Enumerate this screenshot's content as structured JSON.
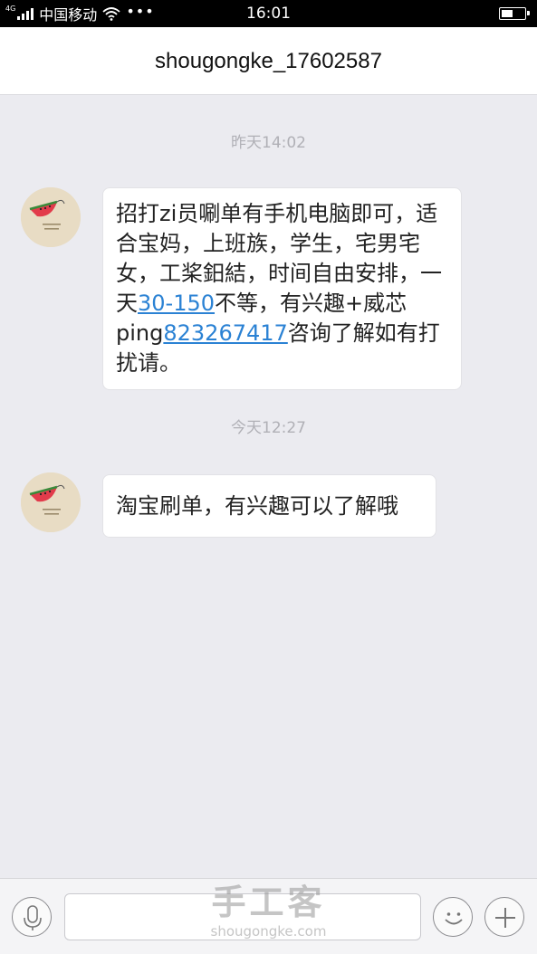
{
  "status_bar": {
    "network_type": "4G",
    "carrier": "中国移动",
    "more": "•••",
    "time": "16:01",
    "battery_level": 0.5
  },
  "header": {
    "title": "shougongke_17602587"
  },
  "messages": [
    {
      "timestamp": "昨天14:02",
      "text_parts": [
        "招打zi员唰单有手机电脑即可，适合宝妈，上班族，学生，宅男宅女，工桨鈤結，时间自由安排，一天",
        "30-150",
        "不等，有兴趣+威芯ping",
        "823267417",
        "咨询了解如有打扰请。"
      ]
    },
    {
      "timestamp": "今天12:27",
      "text": "淘宝刷单，有兴趣可以了解哦"
    }
  ],
  "input_bar": {
    "voice_icon": "microphone-icon",
    "emoji_icon": "smiley-icon",
    "plus_icon": "plus-icon"
  },
  "watermark": {
    "chinese": "手工客",
    "url": "shougongke.com"
  },
  "colors": {
    "background": "#ebebf0",
    "link": "#2b82d4",
    "timestamp": "#b0b0b6",
    "avatar_bg": "#e8dcc4",
    "watermelon": "#e23b4b"
  }
}
